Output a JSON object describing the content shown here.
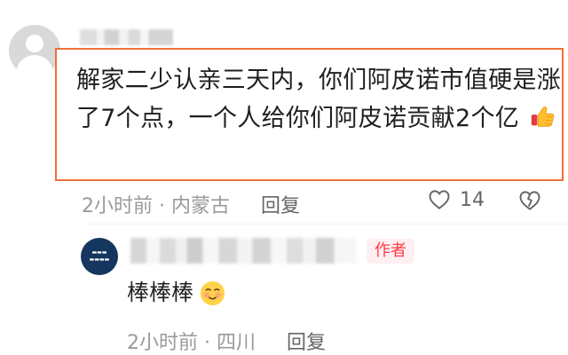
{
  "comments": [
    {
      "text": "解家二少认亲三天内，你们阿皮诺市值硬是涨了7个点，一个人给你们阿皮诺贡献2个亿",
      "emoji_icon": "thumbs-up-icon",
      "time": "2小时前",
      "location": "内蒙古",
      "separator": "·",
      "reply_label": "回复",
      "like_count": "14",
      "like_icon": "heart-icon",
      "dislike_icon": "dislike-icon"
    },
    {
      "badge": "作者",
      "text": "棒棒棒",
      "emoji_icon": "shy-emoji-icon",
      "time": "2小时前",
      "location": "四川",
      "separator": "·",
      "reply_label": "回复"
    }
  ],
  "colors": {
    "highlight_border": "#f06f3a",
    "author_badge_text": "#ff3b48",
    "author_badge_bg": "#ffeff0",
    "meta_text": "#9a9a9a"
  }
}
